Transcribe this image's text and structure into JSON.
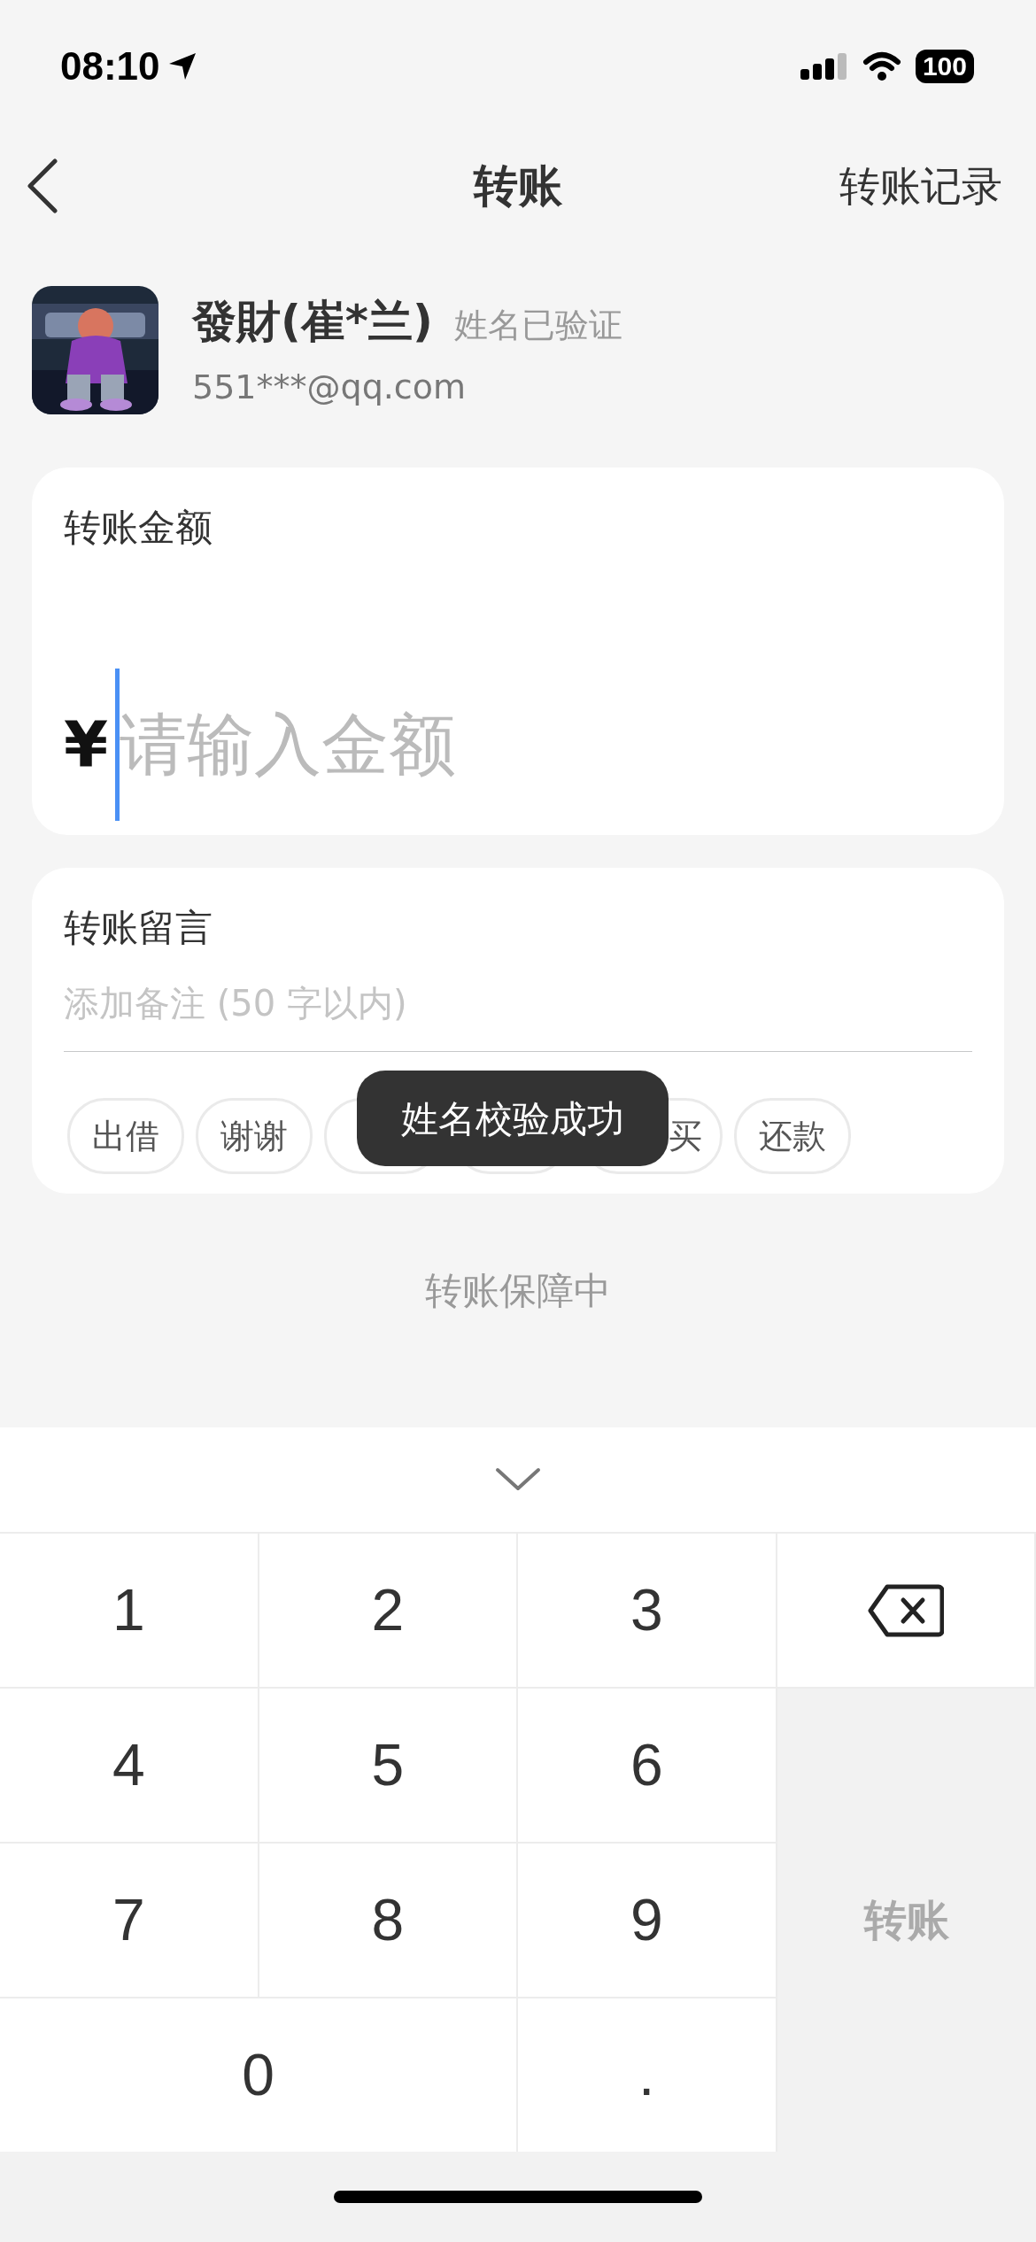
{
  "status_bar": {
    "time": "08:10",
    "battery": "100"
  },
  "nav": {
    "title": "转账",
    "action": "转账记录"
  },
  "payee": {
    "name": "發財(崔*兰)",
    "badge": "姓名已验证",
    "account": "551***@qq.com"
  },
  "amount": {
    "label": "转账金额",
    "currency": "¥",
    "placeholder": "请输入金额",
    "focused": true
  },
  "note": {
    "label": "转账留言",
    "placeholder": "添加备注 (50 字以内)",
    "chips": [
      {
        "kind": "chip",
        "label": "出借"
      },
      {
        "kind": "chip",
        "label": "谢谢"
      },
      {
        "kind": "covered"
      },
      {
        "kind": "covered"
      },
      {
        "kind": "cut",
        "label": "买"
      },
      {
        "kind": "chip",
        "label": "还款"
      }
    ]
  },
  "toast": "姓名校验成功",
  "footer": "转账保障中",
  "keypad": {
    "keys": [
      {
        "kind": "digit",
        "label": "1"
      },
      {
        "kind": "digit",
        "label": "2"
      },
      {
        "kind": "digit",
        "label": "3"
      },
      {
        "kind": "delete"
      },
      {
        "kind": "digit",
        "label": "4"
      },
      {
        "kind": "digit",
        "label": "5"
      },
      {
        "kind": "digit",
        "label": "6"
      },
      {
        "kind": "digit",
        "label": "7"
      },
      {
        "kind": "digit",
        "label": "8"
      },
      {
        "kind": "digit",
        "label": "9"
      },
      {
        "kind": "wide",
        "label": "0"
      },
      {
        "kind": "digit",
        "label": "."
      },
      {
        "kind": "submit",
        "label": "转账",
        "disabled": true
      }
    ]
  }
}
